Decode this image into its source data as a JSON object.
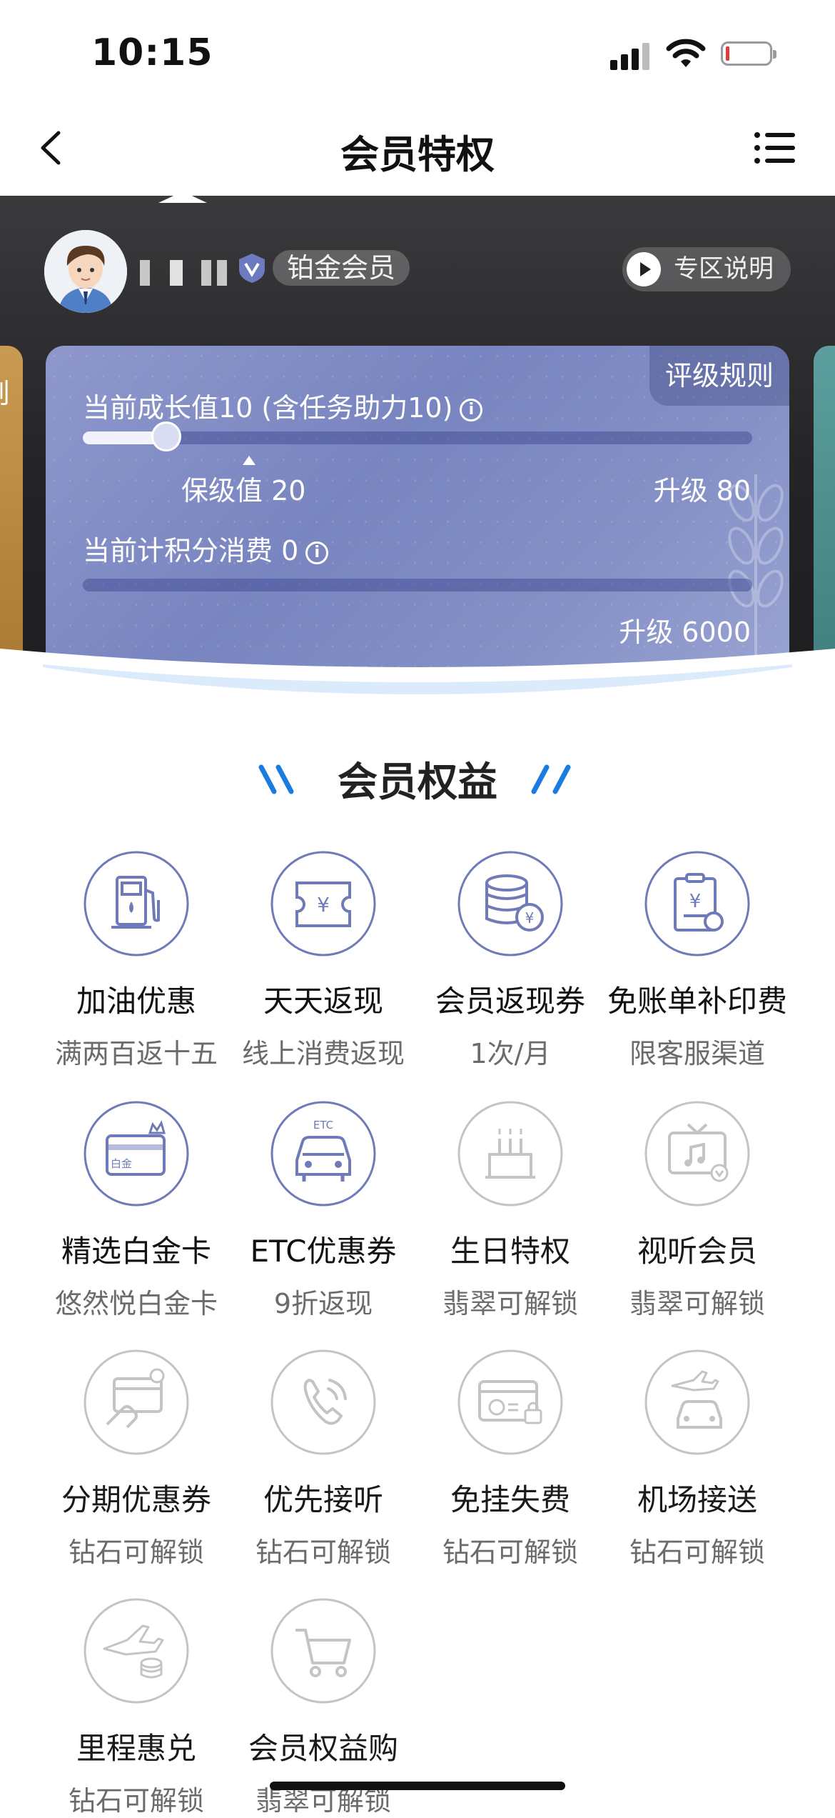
{
  "status_bar": {
    "time": "10:15"
  },
  "nav": {
    "title": "会员特权"
  },
  "profile": {
    "level_badge": "铂金会员",
    "zone_button": "专区说明"
  },
  "side_card_left_text": "则",
  "card": {
    "rules_button": "评级规则",
    "growth_label": "当前成长值10 (含任务助力10)",
    "growth_progress": 0.125,
    "keep_label": "保级值 20",
    "upgrade_growth": "升级 80",
    "points_label": "当前计积分消费 0",
    "points_progress": 0,
    "upgrade_points": "升级 6000"
  },
  "section": {
    "title": "会员权益"
  },
  "benefits": [
    {
      "name": "加油优惠",
      "desc": "满两百返十五",
      "icon": "fuel-pump-icon",
      "locked": false
    },
    {
      "name": "天天返现",
      "desc": "线上消费返现",
      "icon": "yuan-ticket-icon",
      "locked": false
    },
    {
      "name": "会员返现券",
      "desc": "1次/月",
      "icon": "coin-stack-icon",
      "locked": false
    },
    {
      "name": "免账单补印费",
      "desc": "限客服渠道",
      "icon": "bill-clipboard-icon",
      "locked": false
    },
    {
      "name": "精选白金卡",
      "desc": "悠然悦白金卡",
      "icon": "platinum-card-icon",
      "card_text": "白金",
      "locked": false
    },
    {
      "name": "ETC优惠券",
      "desc": "9折返现",
      "icon": "etc-car-icon",
      "card_text": "ETC",
      "locked": false
    },
    {
      "name": "生日特权",
      "desc": "翡翠可解锁",
      "icon": "birthday-cake-icon",
      "locked": true
    },
    {
      "name": "视听会员",
      "desc": "翡翠可解锁",
      "icon": "tv-music-icon",
      "locked": true
    },
    {
      "name": "分期优惠券",
      "desc": "钻石可解锁",
      "icon": "installment-card-icon",
      "locked": true
    },
    {
      "name": "优先接听",
      "desc": "钻石可解锁",
      "icon": "phone-call-icon",
      "locked": true
    },
    {
      "name": "免挂失费",
      "desc": "钻石可解锁",
      "icon": "card-lock-icon",
      "locked": true
    },
    {
      "name": "机场接送",
      "desc": "钻石可解锁",
      "icon": "airport-car-icon",
      "locked": true
    },
    {
      "name": "里程惠兑",
      "desc": "钻石可解锁",
      "icon": "plane-coins-icon",
      "locked": true
    },
    {
      "name": "会员权益购",
      "desc": "翡翠可解锁",
      "icon": "shopping-cart-icon",
      "locked": true
    }
  ],
  "colors": {
    "active_icon": "#6f7ab8",
    "locked_icon": "#c4c4c4",
    "card_bg": "#8590c6",
    "hero_bg": "#242426"
  }
}
